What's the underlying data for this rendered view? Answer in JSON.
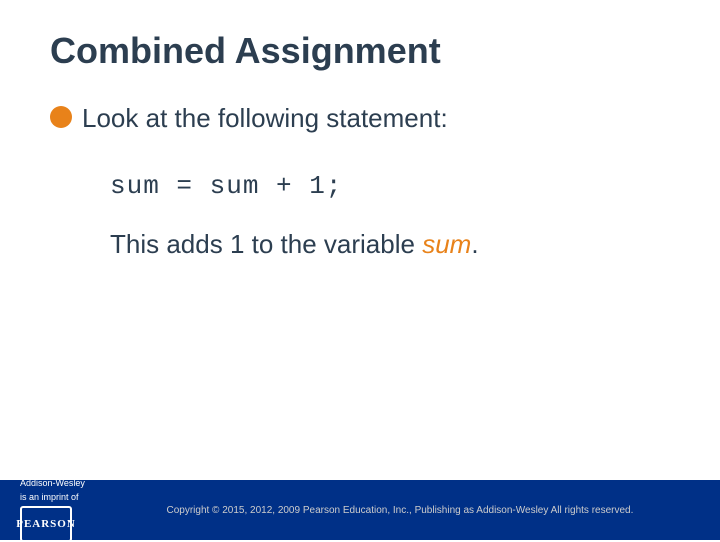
{
  "slide": {
    "title": "Combined Assignment",
    "bullet": {
      "text": "Look at the following statement:"
    },
    "code": "sum = sum + 1;",
    "description": {
      "prefix": "This adds 1 to the variable ",
      "highlighted_word": "sum",
      "suffix": "."
    }
  },
  "footer": {
    "brand_line1": "Addison-Wesley",
    "brand_line2": "is an imprint of",
    "badge_text": "PEARSON",
    "copyright": "Copyright © 2015, 2012, 2009 Pearson Education, Inc., Publishing as Addison-Wesley All rights reserved."
  },
  "colors": {
    "accent": "#e8821a",
    "dark": "#2c3e50",
    "footer_bg": "#003087"
  }
}
